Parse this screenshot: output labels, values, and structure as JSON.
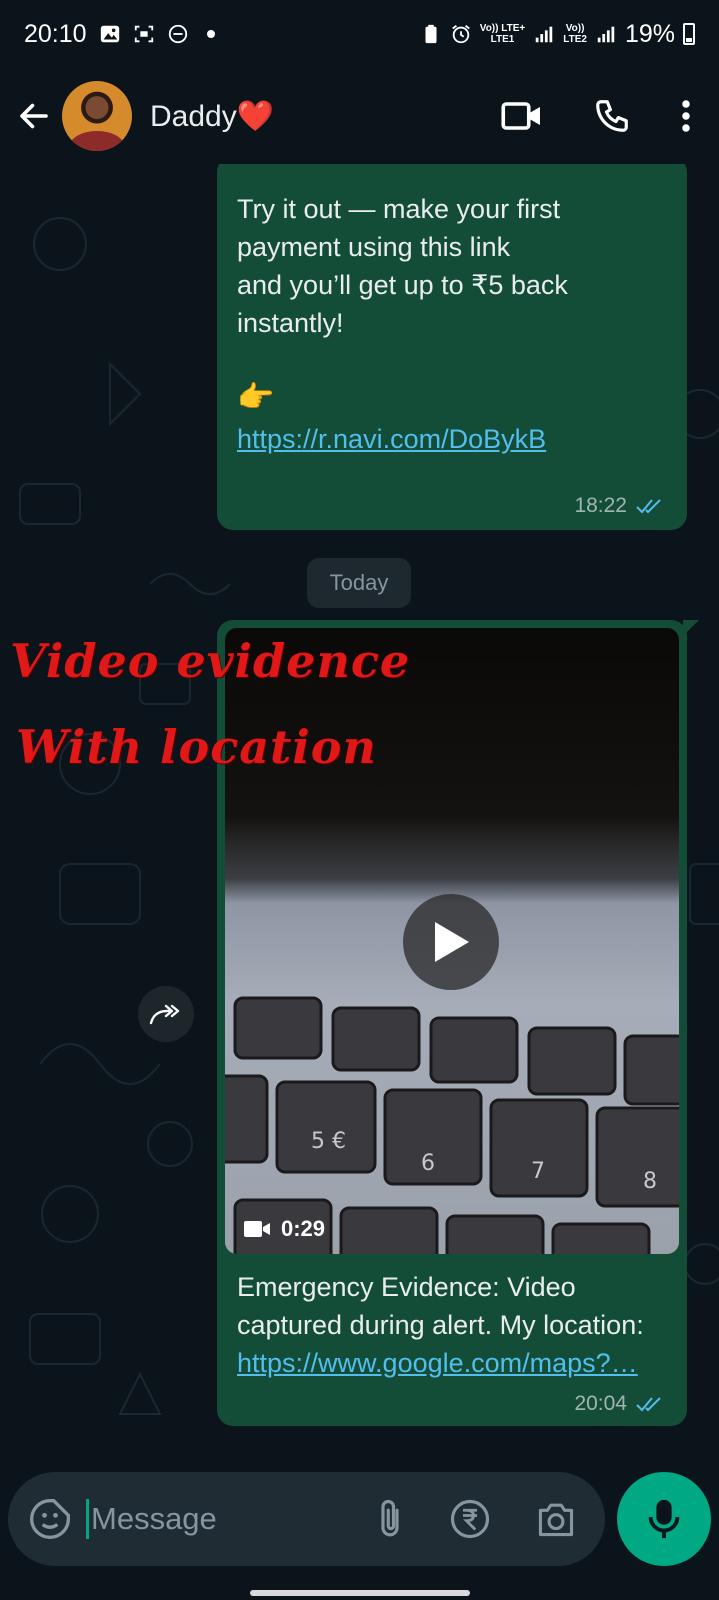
{
  "status_bar": {
    "time": "20:10",
    "sim1_label_top": "Vo)) LTE+",
    "sim1_label_bottom": "LTE1",
    "sim2_label_top": "Vo))",
    "sim2_label_bottom": "LTE2",
    "battery": "19%"
  },
  "header": {
    "contact_name": "Daddy❤️"
  },
  "messages": [
    {
      "lines": [
        "Try it out — make your first",
        "payment using this link",
        "and you’ll get up to ₹5 back",
        "instantly!"
      ],
      "emoji": "👉",
      "link": "https://r.navi.com/DoBykB",
      "time": "18:22",
      "status": "read"
    },
    {
      "video_duration": "0:29",
      "caption_prefix": "Emergency Evidence: Video captured during alert. My location: ",
      "caption_link": "https://www.google.com/maps?…",
      "time": "20:04",
      "status": "read"
    }
  ],
  "date_chip": "Today",
  "overlay": {
    "line1": "Video evidence",
    "line2": "With location"
  },
  "input": {
    "placeholder": "Message"
  },
  "colors": {
    "background": "#0b141a",
    "bubble_outgoing": "#144d37",
    "link": "#53bdeb",
    "accent": "#00a884",
    "overlay_text": "#e01818"
  }
}
